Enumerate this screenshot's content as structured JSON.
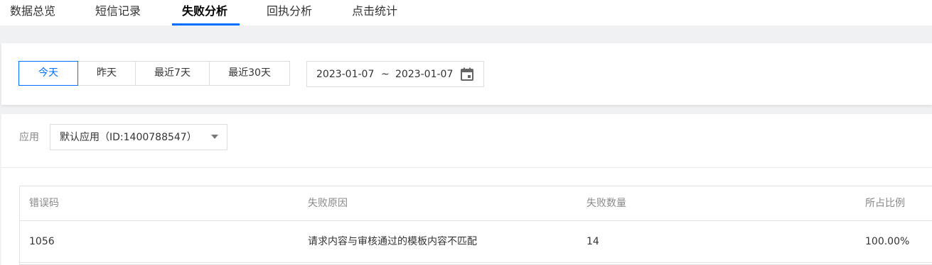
{
  "nav": {
    "tabs": [
      {
        "label": "数据总览"
      },
      {
        "label": "短信记录"
      },
      {
        "label": "失败分析"
      },
      {
        "label": "回执分析"
      },
      {
        "label": "点击统计"
      }
    ],
    "active_tab": "失败分析"
  },
  "date_filter": {
    "ranges": [
      {
        "label": "今天"
      },
      {
        "label": "昨天"
      },
      {
        "label": "最近7天"
      },
      {
        "label": "最近30天"
      }
    ],
    "active_range": "今天",
    "start_date": "2023-01-07",
    "separator": "~",
    "end_date": "2023-01-07",
    "icon": "calendar-icon"
  },
  "app_filter": {
    "label": "应用",
    "selected": "默认应用（ID:1400788547）",
    "icon": "chevron-down-icon"
  },
  "table": {
    "columns": [
      "错误码",
      "失败原因",
      "失败数量",
      "所占比例"
    ],
    "rows": [
      {
        "code": "1056",
        "reason": "请求内容与审核通过的模板内容不匹配",
        "count": "14",
        "ratio": "100.00%"
      }
    ]
  },
  "colors": {
    "accent": "#006eff",
    "background": "#f0f1f3"
  }
}
